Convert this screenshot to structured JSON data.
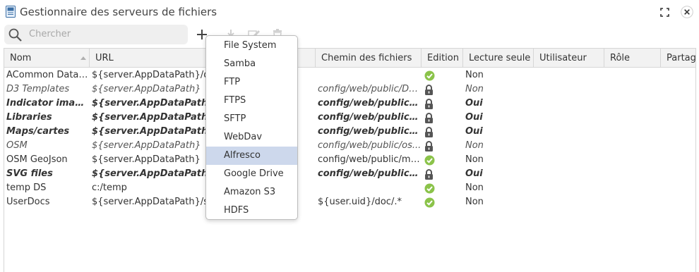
{
  "window": {
    "title": "Gestionnaire des serveurs de fichiers"
  },
  "search": {
    "placeholder": "Chercher"
  },
  "colors": {
    "check": "#8bc34a",
    "lock": "#555555",
    "selected": "#cdd8ec"
  },
  "columns": [
    "Nom",
    "URL",
    "Chemin des fichiers",
    "Edition",
    "Lecture seule",
    "Utilisateur",
    "Rôle",
    "Partag"
  ],
  "rows": [
    {
      "name": "ACommon Datas...",
      "url": "${server.AppDataPath}/dat",
      "path": "",
      "edit": "check-icon",
      "ro": "Non",
      "style": "normal"
    },
    {
      "name": "D3 Templates",
      "url": "${server.AppDataPath}",
      "path": "config/web/public/D3...",
      "edit": "lock-icon",
      "ro": "Non",
      "style": "italic"
    },
    {
      "name": "Indicator images",
      "url": "${server.AppDataPath}",
      "path": "config/web/public/ind...",
      "edit": "lock-icon",
      "ro": "Oui",
      "style": "bold"
    },
    {
      "name": "Libraries",
      "url": "${server.AppDataPath}",
      "path": "config/web/public/lib/.*",
      "edit": "lock-icon",
      "ro": "Oui",
      "style": "bold"
    },
    {
      "name": "Maps/cartes",
      "url": "${server.AppDataPath}",
      "path": "config/web/public/ma...",
      "edit": "lock-icon",
      "ro": "Oui",
      "style": "bold"
    },
    {
      "name": "OSM",
      "url": "${server.AppDataPath}",
      "path": "config/web/public/os...",
      "edit": "lock-icon",
      "ro": "Non",
      "style": "italic"
    },
    {
      "name": "OSM GeoJson",
      "url": "${server.AppDataPath}",
      "path": "config/web/public/ma...",
      "edit": "check-icon",
      "ro": "Non",
      "style": "normal"
    },
    {
      "name": "SVG files",
      "url": "${server.AppDataPath}",
      "path": "config/web/public/vec...",
      "edit": "lock-icon",
      "ro": "Oui",
      "style": "bold"
    },
    {
      "name": "temp DS",
      "url": "c:/temp",
      "path": "",
      "edit": "check-icon",
      "ro": "Non",
      "style": "normal"
    },
    {
      "name": "UserDocs",
      "url": "${server.AppDataPath}/ser",
      "path": "${user.uid}/doc/.*",
      "edit": "check-icon",
      "ro": "Non",
      "style": "normal"
    }
  ],
  "add_menu": {
    "items": [
      "File System",
      "Samba",
      "FTP",
      "FTPS",
      "SFTP",
      "WebDav",
      "Alfresco",
      "Google Drive",
      "Amazon S3",
      "HDFS"
    ],
    "selected": "Alfresco"
  }
}
